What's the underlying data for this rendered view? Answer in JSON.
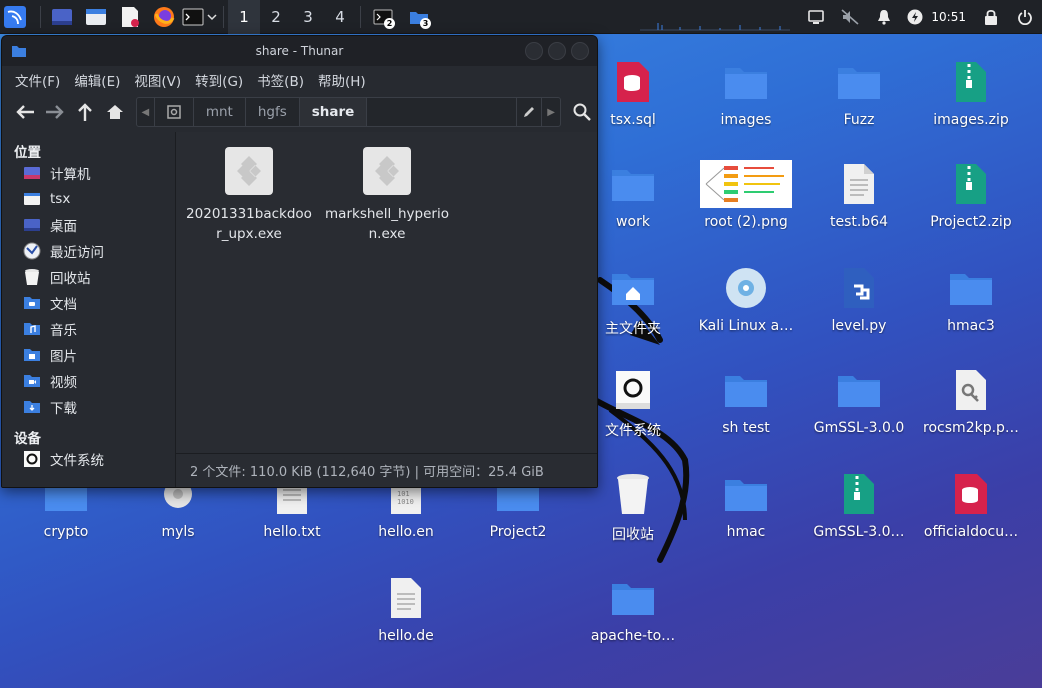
{
  "panel": {
    "workspaces": [
      "1",
      "2",
      "3",
      "4"
    ],
    "active_workspace": "1",
    "terminal_badge": "2",
    "files_badge": "3",
    "clock": "10:51"
  },
  "window": {
    "title": "share - Thunar",
    "menu": [
      "文件(F)",
      "编辑(E)",
      "视图(V)",
      "转到(G)",
      "书签(B)",
      "帮助(H)"
    ],
    "path": [
      "mnt",
      "hgfs",
      "share"
    ],
    "sidebar": {
      "places_header": "位置",
      "places": [
        "计算机",
        "tsx",
        "桌面",
        "最近访问",
        "回收站",
        "文档",
        "音乐",
        "图片",
        "视频",
        "下载"
      ],
      "devices_header": "设备",
      "devices": [
        "文件系统"
      ]
    },
    "files": [
      "20201331backdoor_upx.exe",
      "markshell_hyperion.exe"
    ],
    "status": "2 个文件: 110.0 KiB (112,640 字节) | 可用空间：25.4 GiB"
  },
  "desktop": {
    "row1": [
      "tsx.sql",
      "images",
      "Fuzz",
      "images.zip"
    ],
    "row2": [
      "work",
      "root (2).png",
      "test.b64",
      "Project2.zip"
    ],
    "row3": [
      "主文件夹",
      "Kali Linux a…",
      "level.py",
      "hmac3"
    ],
    "row4": [
      "文件系统",
      "sh test",
      "GmSSL-3.0.0",
      "rocsm2kp.p…"
    ],
    "row5": [
      "crypto",
      "myls",
      "hello.txt",
      "hello.en",
      "Project2",
      "回收站",
      "hmac",
      "GmSSL-3.0…",
      "officialdocu…"
    ],
    "row6": [
      "hello.de",
      "apache-to…"
    ]
  },
  "colors": {
    "folder": "#3b7fe0",
    "panel": "#1f2227",
    "window": "#272a30",
    "accent": "#367bf0",
    "db_red": "#d6224c",
    "zip_teal": "#17a085"
  }
}
